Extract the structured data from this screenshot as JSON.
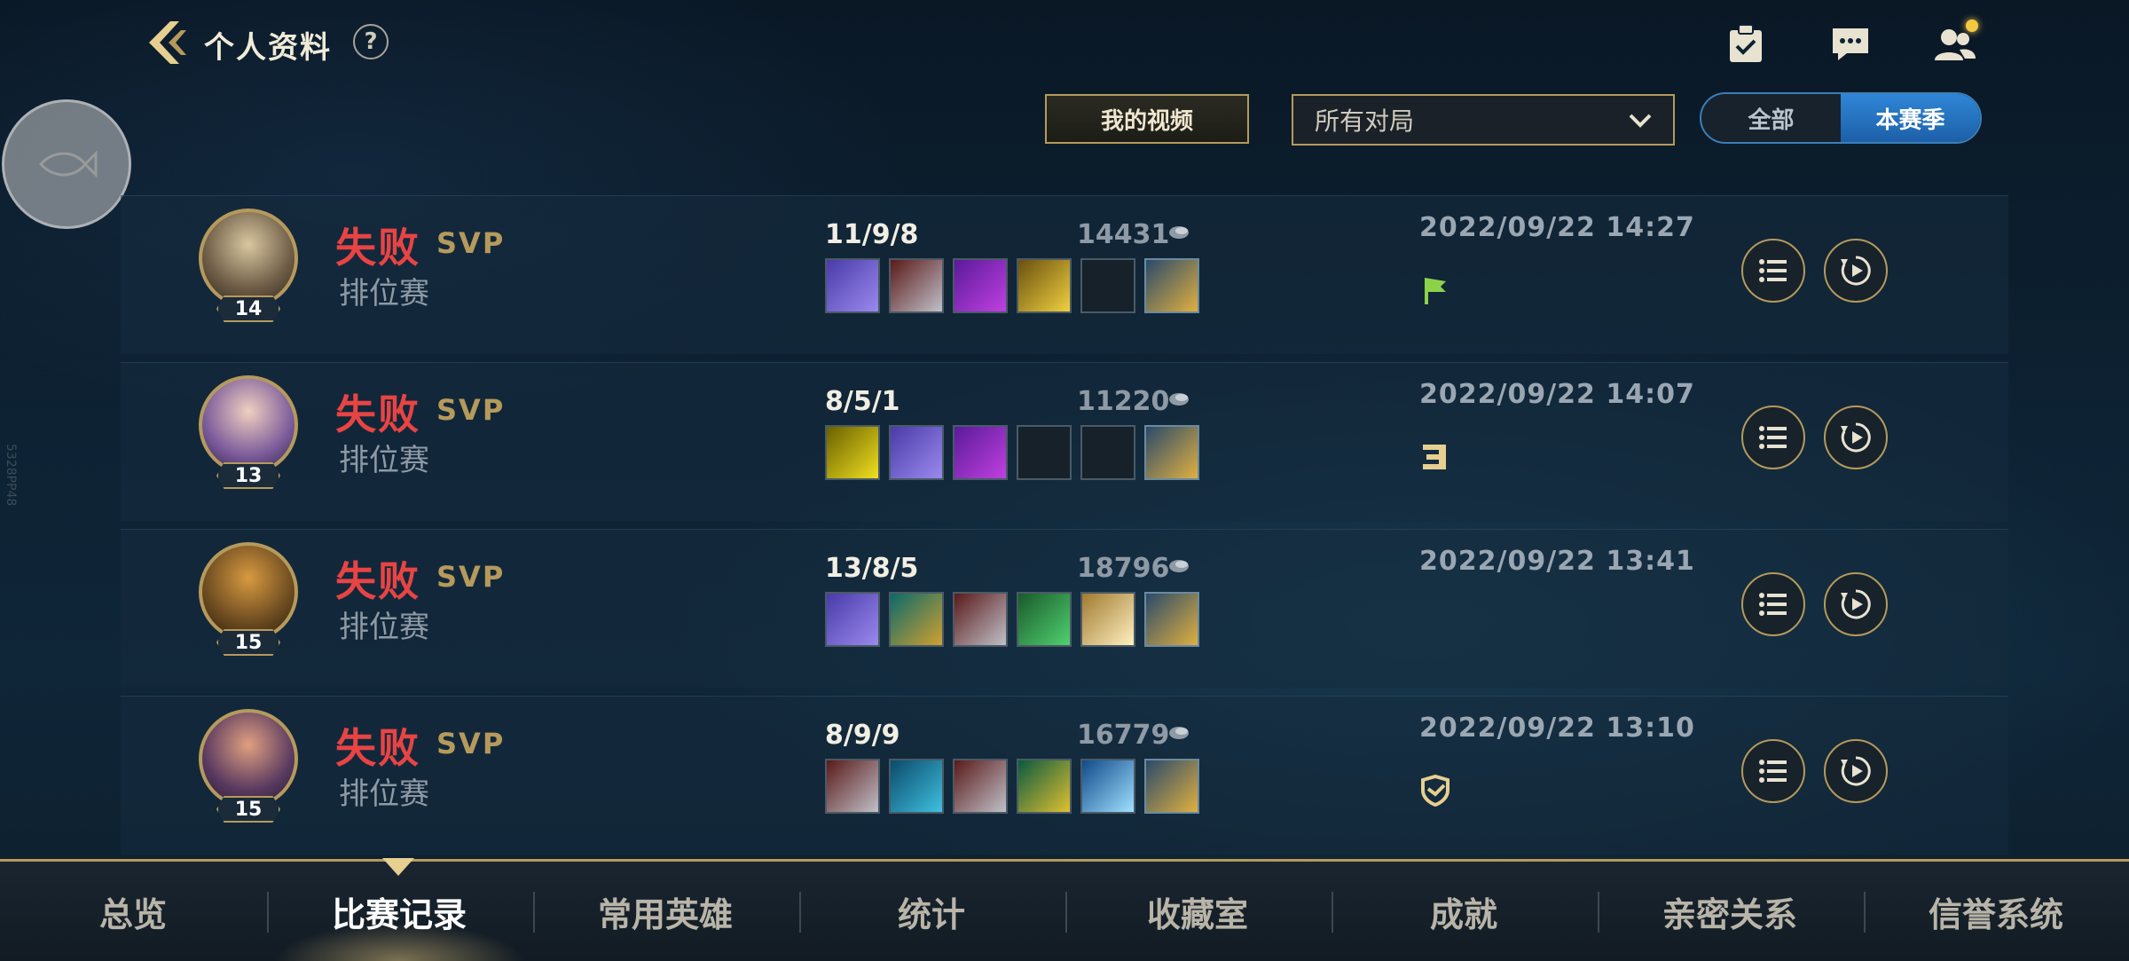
{
  "header": {
    "title": "个人资料",
    "help_label": "?"
  },
  "side_watermark": "5328PP48",
  "filters": {
    "video_button": "我的视频",
    "match_filter_value": "所有对局",
    "season_toggle": [
      "全部",
      "本赛季"
    ],
    "season_selected": "本赛季"
  },
  "matches": [
    {
      "level": "14",
      "result": "失败",
      "badge": "SVP",
      "mode": "排位赛",
      "kda": "11/9/8",
      "gold": "14431",
      "date": "2022/09/22 14:27",
      "tag_icon": "flag-icon",
      "items": [
        "blade-item-icon",
        "cleaver-item-icon",
        "scythe-item-icon",
        "dagger-item-icon",
        "empty-slot",
        "trinket-icon"
      ]
    },
    {
      "level": "13",
      "result": "失败",
      "badge": "SVP",
      "mode": "排位赛",
      "kda": "8/5/1",
      "gold": "11220",
      "date": "2022/09/22 14:07",
      "tag_icon": "streak-icon",
      "items": [
        "triforce-item-icon",
        "blade-item-icon",
        "scythe-item-icon",
        "empty-slot",
        "empty-slot",
        "trinket-icon"
      ]
    },
    {
      "level": "15",
      "result": "失败",
      "badge": "SVP",
      "mode": "排位赛",
      "kda": "13/8/5",
      "gold": "18796",
      "date": "2022/09/22 13:41",
      "tag_icon": "",
      "items": [
        "blade-item-icon",
        "helmet-item-icon",
        "cleaver-item-icon",
        "gauntlet-item-icon",
        "wings-item-icon",
        "trinket-icon"
      ]
    },
    {
      "level": "15",
      "result": "失败",
      "badge": "SVP",
      "mode": "排位赛",
      "kda": "8/9/9",
      "gold": "16779",
      "date": "2022/09/22 13:10",
      "tag_icon": "shield-tag-icon",
      "items": [
        "cleaver-item-icon",
        "armor-item-icon",
        "cleaver-item-icon",
        "crown-item-icon",
        "crystal-item-icon",
        "trinket-icon"
      ]
    }
  ],
  "tabs": [
    "总览",
    "比赛记录",
    "常用英雄",
    "统计",
    "收藏室",
    "成就",
    "亲密关系",
    "信誉系统"
  ],
  "active_tab": "比赛记录",
  "colors": {
    "accent_gold": "#b59a5c",
    "loss_red": "#e84444",
    "toggle_blue": "#2f86d6"
  }
}
